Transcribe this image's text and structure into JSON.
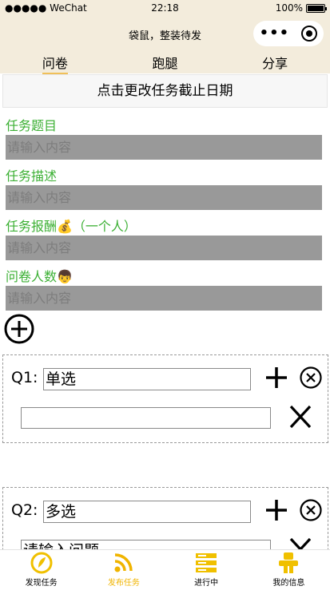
{
  "status_bar": {
    "carrier": "●●●●● WeChat",
    "time": "22:18",
    "battery": "100%",
    "battery_level": 1.0
  },
  "nav": {
    "title": "袋鼠，整装待发",
    "menu_dots": "•••"
  },
  "tabs": [
    {
      "label": "问卷",
      "active": true
    },
    {
      "label": "跑腿",
      "active": false
    },
    {
      "label": "分享",
      "active": false
    }
  ],
  "deadline_button": "点击更改任务截止日期",
  "fields": [
    {
      "label": "任务题目",
      "placeholder": "请输入内容"
    },
    {
      "label": "任务描述",
      "placeholder": "请输入内容"
    },
    {
      "label": "任务报酬💰（一个人）",
      "placeholder": "请输入内容"
    },
    {
      "label": "问卷人数👦",
      "placeholder": "请输入内容"
    }
  ],
  "questions": [
    {
      "label": "Q1:",
      "type_value": "单选",
      "option_value": ""
    },
    {
      "label": "Q2:",
      "type_value": "多选",
      "option_value": "请输入问题"
    }
  ],
  "tabbar": [
    {
      "label": "发现任务",
      "icon": "discover-icon",
      "active": false
    },
    {
      "label": "发布任务",
      "icon": "rss-icon",
      "active": true
    },
    {
      "label": "进行中",
      "icon": "list-icon",
      "active": false
    },
    {
      "label": "我的信息",
      "icon": "profile-icon",
      "active": false
    }
  ],
  "colors": {
    "header_bg": "#f3ecdc",
    "label_green": "#3cb034",
    "input_gray": "#999999",
    "accent_yellow": "#f0c05a"
  }
}
